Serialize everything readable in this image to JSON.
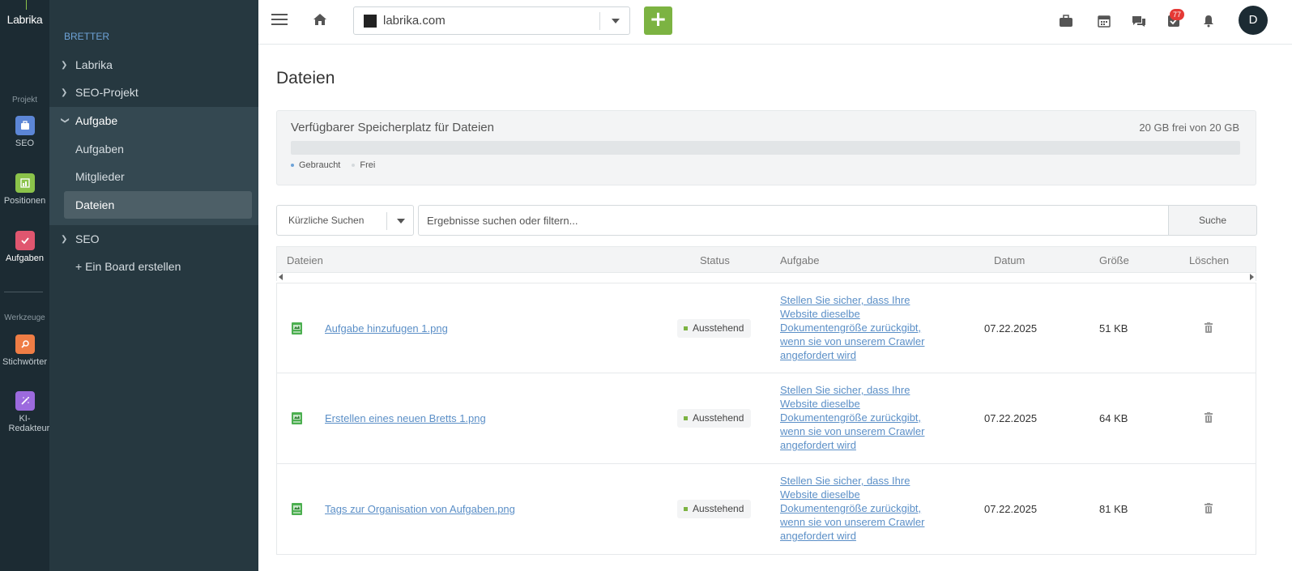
{
  "app": {
    "logo": "Labrika"
  },
  "rail": {
    "section_project": "Projekt",
    "section_tools": "Werkzeuge",
    "items": [
      {
        "label": "SEO",
        "icon": "seo-briefcase-icon",
        "color": "#5c86d6"
      },
      {
        "label": "Positionen",
        "icon": "positions-chart-icon",
        "color": "#8bc34a"
      },
      {
        "label": "Aufgaben",
        "icon": "tasks-check-icon",
        "color": "#e0566f"
      },
      {
        "label": "Stichwörter",
        "icon": "keywords-icon",
        "color": "#ef7d45"
      },
      {
        "label": "KI-Redakteur",
        "icon": "ai-editor-wand-icon",
        "color": "#9c6ade"
      }
    ]
  },
  "boards": {
    "heading": "BRETTER",
    "items": [
      "Labrika",
      "SEO-Projekt",
      "Aufgabe",
      "SEO"
    ],
    "subitems": [
      "Aufgaben",
      "Mitglieder",
      "Dateien"
    ],
    "create": "+ Ein Board erstellen"
  },
  "topbar": {
    "site": "labrika.com",
    "add_label": "+",
    "notification_count": "77",
    "avatar_initial": "D",
    "accent": "#7cb342"
  },
  "page": {
    "title": "Dateien"
  },
  "storage": {
    "title": "Verfügbarer Speicherplatz für Dateien",
    "free_text": "20 GB frei von 20 GB",
    "used_fraction": 0,
    "legend_used": "Gebraucht",
    "legend_free": "Frei"
  },
  "search": {
    "recent_label": "Kürzliche Suchen",
    "placeholder": "Ergebnisse suchen oder filtern...",
    "button": "Suche"
  },
  "table": {
    "columns": [
      "Dateien",
      "Status",
      "Aufgabe",
      "Datum",
      "Größe",
      "Löschen"
    ],
    "rows": [
      {
        "file": "Aufgabe hinzufugen 1.png",
        "status": "Ausstehend",
        "task": "Stellen Sie sicher, dass Ihre Website dieselbe Dokumentengröße zurückgibt, wenn sie von unserem Crawler angefordert wird",
        "date": "07.22.2025",
        "size": "51 KB"
      },
      {
        "file": "Erstellen eines neuen Bretts 1.png",
        "status": "Ausstehend",
        "task": "Stellen Sie sicher, dass Ihre Website dieselbe Dokumentengröße zurückgibt, wenn sie von unserem Crawler angefordert wird",
        "date": "07.22.2025",
        "size": "64 KB"
      },
      {
        "file": "Tags zur Organisation von Aufgaben.png",
        "status": "Ausstehend",
        "task": "Stellen Sie sicher, dass Ihre Website dieselbe Dokumentengröße zurückgibt, wenn sie von unserem Crawler angefordert wird",
        "date": "07.22.2025",
        "size": "81 KB"
      }
    ]
  }
}
